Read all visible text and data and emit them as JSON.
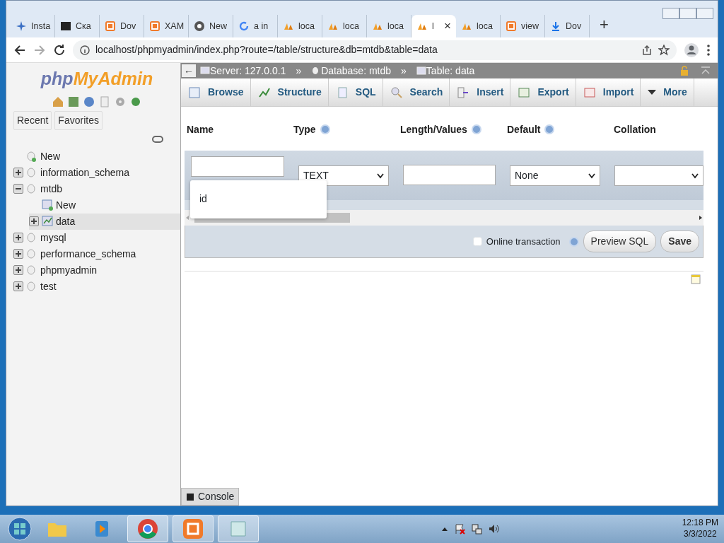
{
  "browser": {
    "tabs": [
      {
        "label": "Insta",
        "selected": false
      },
      {
        "label": "Ска",
        "selected": false
      },
      {
        "label": "Dov",
        "selected": false
      },
      {
        "label": "XAM",
        "selected": false
      },
      {
        "label": "New",
        "selected": false
      },
      {
        "label": "a in",
        "selected": false
      },
      {
        "label": "loca",
        "selected": false
      },
      {
        "label": "loca",
        "selected": false
      },
      {
        "label": "loca",
        "selected": false
      },
      {
        "label": "l",
        "selected": true
      },
      {
        "label": "loca",
        "selected": false
      },
      {
        "label": "view",
        "selected": false
      },
      {
        "label": "Dov",
        "selected": false
      }
    ],
    "new_tab": "+",
    "close_tab": "×",
    "address": "localhost/phpmyadmin/index.php?route=/table/structure&db=mtdb&table=data"
  },
  "sidebar": {
    "logo_php": "php",
    "logo_rest": "MyAdmin",
    "buttons": [
      "Recent",
      "Favorites"
    ],
    "tree": [
      {
        "label": "New",
        "kind": "new",
        "selected": false
      },
      {
        "label": "information_schema",
        "kind": "db",
        "expanded": false,
        "selected": false
      },
      {
        "label": "mtdb",
        "kind": "db",
        "expanded": true,
        "selected": false,
        "children": [
          {
            "label": "New",
            "kind": "newtable",
            "selected": false
          },
          {
            "label": "data",
            "kind": "table",
            "expanded": false,
            "selected": true
          }
        ]
      },
      {
        "label": "mysql",
        "kind": "db",
        "expanded": false,
        "selected": false
      },
      {
        "label": "performance_schema",
        "kind": "db",
        "expanded": false,
        "selected": false
      },
      {
        "label": "phpmyadmin",
        "kind": "db",
        "expanded": false,
        "selected": false
      },
      {
        "label": "test",
        "kind": "db",
        "expanded": false,
        "selected": false
      }
    ]
  },
  "breadcrumb": [
    "Server: 127.0.0.1",
    "Database: mtdb",
    "Table: data"
  ],
  "breadcrumb_sep": "»",
  "collapse": "←",
  "menu_tabs": [
    "Browse",
    "Structure",
    "SQL",
    "Search",
    "Insert",
    "Export",
    "Import",
    "More"
  ],
  "columns": [
    {
      "label": "Name",
      "kind": "plain"
    },
    {
      "label": "Type",
      "kind": "help"
    },
    {
      "label": "Length/Values",
      "kind": "help"
    },
    {
      "label": "Default",
      "kind": "help"
    },
    {
      "label": "Collation",
      "kind": "plain"
    }
  ],
  "row": {
    "type": "TEXT",
    "default": "None"
  },
  "autocomplete": [
    "id"
  ],
  "online_transaction": {
    "label": "Online transaction",
    "checked": false
  },
  "actions": [
    "Preview SQL",
    "Save"
  ],
  "console": "Console",
  "taskbar": {
    "apps": [
      {
        "selected": false
      },
      {
        "selected": false
      },
      {
        "selected": true
      },
      {
        "selected": true
      },
      {
        "selected": true
      }
    ],
    "time": "12:18 PM",
    "date": "3/3/2022"
  }
}
